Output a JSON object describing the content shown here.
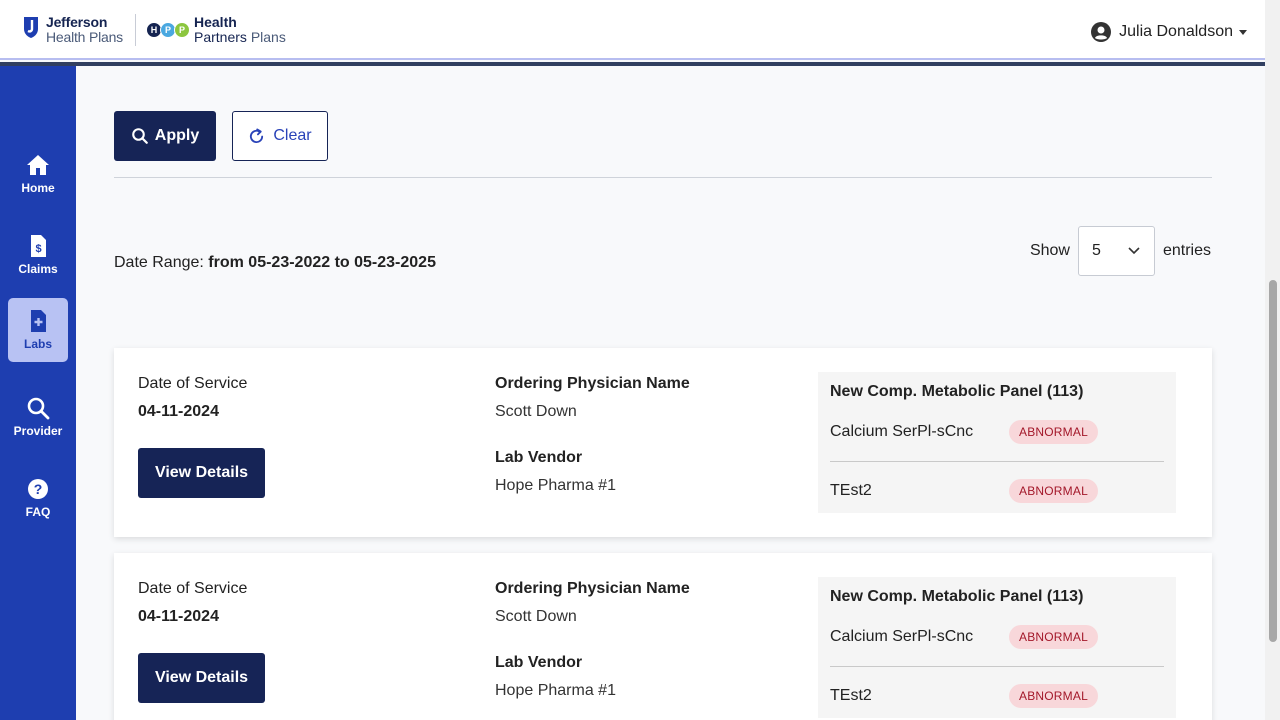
{
  "header": {
    "logo_jefferson_line1": "Jefferson",
    "logo_jefferson_line2": "Health Plans",
    "logo_hpp_letters": [
      "H",
      "P",
      "P"
    ],
    "logo_hpp_line1": "Health",
    "logo_hpp_line2a": "Partners",
    "logo_hpp_line2b": "Plans",
    "user_name": "Julia Donaldson",
    "colors": {
      "navy": "#162456",
      "sidebar": "#1e3eb0"
    }
  },
  "sidebar": {
    "items": [
      {
        "label": "Home",
        "icon": "home-icon"
      },
      {
        "label": "Claims",
        "icon": "claims-icon"
      },
      {
        "label": "Labs",
        "icon": "labs-icon",
        "active": true
      },
      {
        "label": "Provider",
        "icon": "search-icon"
      },
      {
        "label": "FAQ",
        "icon": "question-icon"
      }
    ]
  },
  "filters": {
    "apply_label": "Apply",
    "clear_label": "Clear"
  },
  "results": {
    "date_range_label": "Date Range:",
    "date_range_value": "from 05-23-2022 to 05-23-2025",
    "show_label": "Show",
    "entries_label": "entries",
    "page_size": "5"
  },
  "cards": [
    {
      "dos_label": "Date of Service",
      "dos_value": "04-11-2024",
      "view_label": "View Details",
      "physician_label": "Ordering Physician Name",
      "physician_value": "Scott Down",
      "vendor_label": "Lab Vendor",
      "vendor_value": "Hope Pharma #1",
      "panel_title": "New Comp. Metabolic Panel (113)",
      "tests": [
        {
          "name": "Calcium SerPl-sCnc",
          "status": "ABNORMAL"
        },
        {
          "name": "TEst2",
          "status": "ABNORMAL"
        }
      ]
    },
    {
      "dos_label": "Date of Service",
      "dos_value": "04-11-2024",
      "view_label": "View Details",
      "physician_label": "Ordering Physician Name",
      "physician_value": "Scott Down",
      "vendor_label": "Lab Vendor",
      "vendor_value": "Hope Pharma #1",
      "panel_title": "New Comp. Metabolic Panel (113)",
      "tests": [
        {
          "name": "Calcium SerPl-sCnc",
          "status": "ABNORMAL"
        },
        {
          "name": "TEst2",
          "status": "ABNORMAL"
        }
      ]
    }
  ]
}
